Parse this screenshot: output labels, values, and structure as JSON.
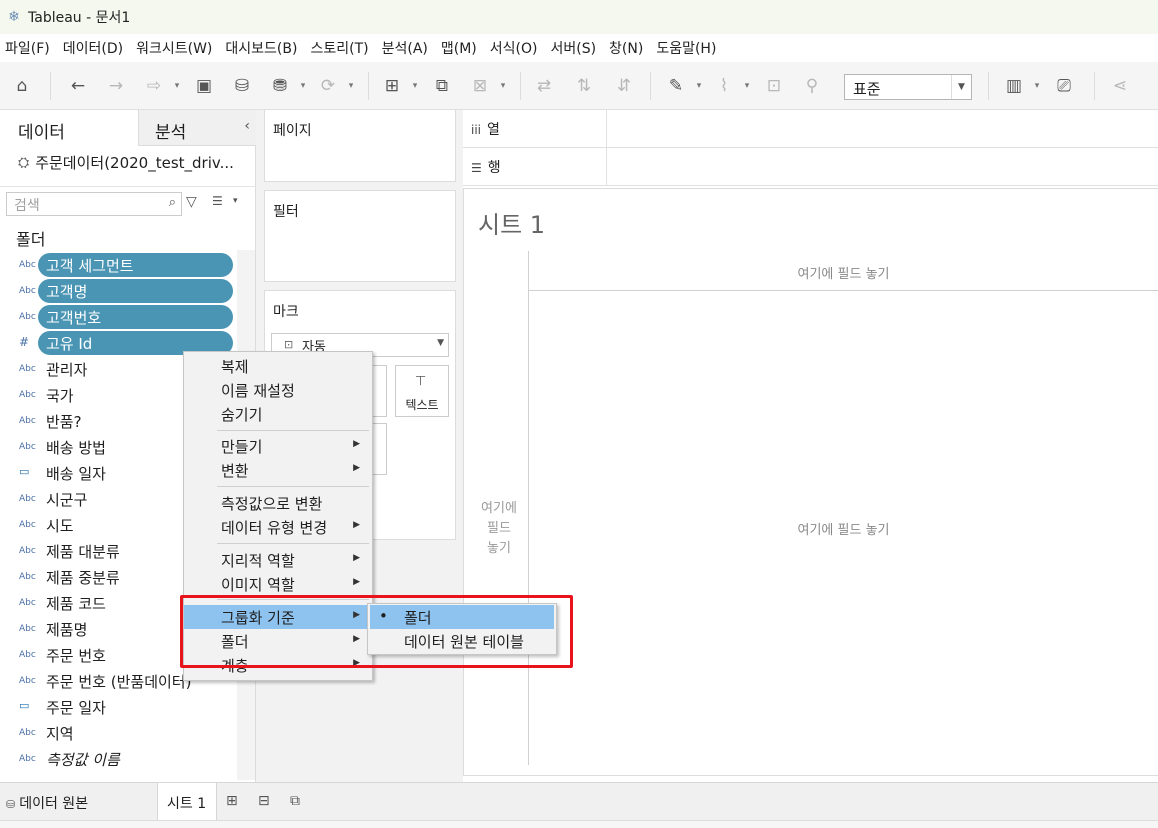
{
  "window": {
    "title": "Tableau - 문서1"
  },
  "menubar": [
    "파일(F)",
    "데이터(D)",
    "워크시트(W)",
    "대시보드(B)",
    "스토리(T)",
    "분석(A)",
    "맵(M)",
    "서식(O)",
    "서버(S)",
    "창(N)",
    "도움말(H)"
  ],
  "toolbar": {
    "fit_select": "표준"
  },
  "data_pane": {
    "tab_data": "데이터",
    "tab_analysis": "분석",
    "datasource": "주문데이터(2020_test_driv...",
    "search_placeholder": "검색",
    "folder_header": "폴더",
    "fields": [
      {
        "type": "Abc",
        "name": "고객 세그먼트"
      },
      {
        "type": "Abc",
        "name": "고객명"
      },
      {
        "type": "Abc",
        "name": "고객번호"
      },
      {
        "type": "#",
        "name": "고유 Id"
      },
      {
        "type": "Abc",
        "name": "관리자"
      },
      {
        "type": "Abc",
        "name": "국가"
      },
      {
        "type": "Abc",
        "name": "반품?"
      },
      {
        "type": "Abc",
        "name": "배송 방법"
      },
      {
        "type": "date",
        "name": "배송 일자"
      },
      {
        "type": "Abc",
        "name": "시군구"
      },
      {
        "type": "Abc",
        "name": "시도"
      },
      {
        "type": "Abc",
        "name": "제품 대분류"
      },
      {
        "type": "Abc",
        "name": "제품 중분류"
      },
      {
        "type": "Abc",
        "name": "제품 코드"
      },
      {
        "type": "Abc",
        "name": "제품명"
      },
      {
        "type": "Abc",
        "name": "주문 번호"
      },
      {
        "type": "Abc",
        "name": "주문 번호 (반품데이터)"
      },
      {
        "type": "date",
        "name": "주문 일자"
      },
      {
        "type": "Abc",
        "name": "지역"
      },
      {
        "type": "Abc",
        "name": "측정값 이름"
      }
    ]
  },
  "cards": {
    "pages": "페이지",
    "filters": "필터",
    "marks": "마크",
    "marks_type": "자동",
    "marks_text_btn": "텍스트"
  },
  "shelves": {
    "columns": "열",
    "rows": "행"
  },
  "sheet": {
    "title": "시트 1",
    "drop_columns": "여기에 필드 놓기",
    "drop_rows_line1": "여기에",
    "drop_rows_line2": "필드",
    "drop_rows_line3": "놓기",
    "drop_main": "여기에 필드 놓기"
  },
  "bottom": {
    "datasource_tab": "데이터 원본",
    "sheet_tab": "시트 1"
  },
  "context_menu": {
    "items": [
      "복제",
      "이름 재설정",
      "숨기기",
      "만들기",
      "변환",
      "측정값으로 변환",
      "데이터 유형 변경",
      "지리적 역할",
      "이미지 역할",
      "그룹화 기준",
      "폴더",
      "계층"
    ],
    "submenu": [
      "폴더",
      "데이터 원본 테이블"
    ]
  },
  "colors": {
    "pill": "#4a94b4",
    "menu_highlight": "#8ec3ef",
    "annotation": "#e8141c"
  }
}
